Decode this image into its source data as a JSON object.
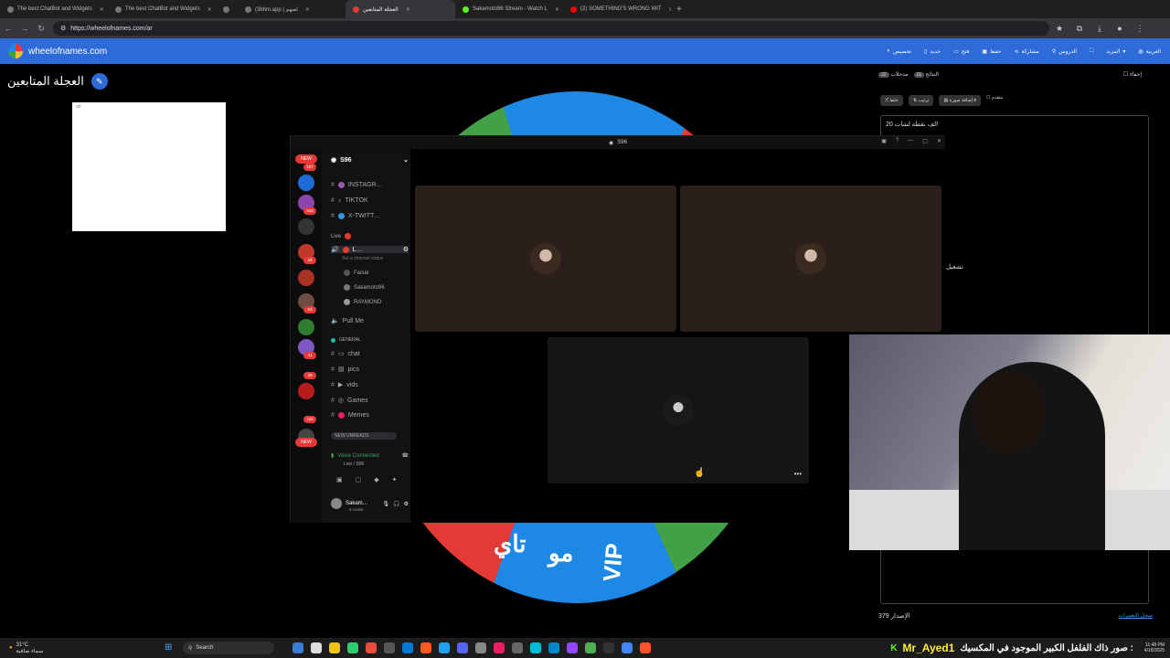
{
  "browser": {
    "tabs": [
      {
        "label": "The best ChatBot and Widgets"
      },
      {
        "label": "The best ChatBot and Widgets"
      },
      {
        "label": "(3bhm.app | لعبهم"
      },
      {
        "label": "العجلة المتابعين",
        "active": true
      },
      {
        "label": "Sakamoto96 Stream - Watch L"
      },
      {
        "label": "(2) SOMETHING'S WRONG WIT"
      }
    ],
    "url": "https://wheelofnames.com/ar"
  },
  "site": {
    "name": "wheelofnames.com",
    "menu": [
      "تخصيص",
      "جديد",
      "فتح",
      "حفظ",
      "مشاركة",
      "الدروس",
      "المزيد",
      "العربية"
    ]
  },
  "page": {
    "title": "العجلة المتابعين",
    "whitebox_text": "ab"
  },
  "wheel": {
    "labels": [
      "VIP",
      "مو",
      "تاي"
    ]
  },
  "right_panel": {
    "tabs": [
      {
        "label": "مدخلات",
        "count": "22"
      },
      {
        "label": "النتائج",
        "count": "11"
      }
    ],
    "hide_label": "إخفاء",
    "tools": [
      "خلط",
      "ترتيب",
      "إضافة صورة",
      "متقدم"
    ],
    "entry_text": "الف نقطة لشات 20",
    "side_label": "تشغيل",
    "footer_count": "الإصدار 379",
    "footer_link": "سجل التغييرات"
  },
  "discord": {
    "window_title": "S96",
    "server_name": "S96",
    "server_badges": {
      "new1": "NEW",
      "c1": "107",
      "c2": "219",
      "c3": "29",
      "c4": "53",
      "c5": "41",
      "c6": "28",
      "c7": "116",
      "new2": "NEW"
    },
    "channels": [
      {
        "name": "INSTAGR…",
        "color": "#9b59b6"
      },
      {
        "name": "TIKTOK",
        "color": "#333"
      },
      {
        "name": "X-TWITT…",
        "color": "#3498db"
      }
    ],
    "live_label": "Live",
    "live_channel": "L…",
    "status_prompt": "Set a channel status",
    "voice_members": [
      "Faisal",
      "Sakamoto96",
      "RAYMOND"
    ],
    "pull_me": "Pull Me",
    "general_label": "GENERAL",
    "text_channels": [
      "chat",
      "pics",
      "vids",
      "Games",
      "Memes"
    ],
    "new_unreads": "NEW UNREADS",
    "voice_connected": "Voice Connected",
    "voice_sub": "Live / S96",
    "user_name": "Sakam…",
    "user_status": "In voice"
  },
  "taskbar": {
    "weather_temp": "31°C",
    "weather_desc": "سماء صافية",
    "search": "Search",
    "ticker_name": "Mr_Ayed1",
    "ticker_text": "صور ذاك الفلفل الكبير الموجود في المكسيك :",
    "time": "11:48 PM",
    "date": "4/18/2025"
  }
}
